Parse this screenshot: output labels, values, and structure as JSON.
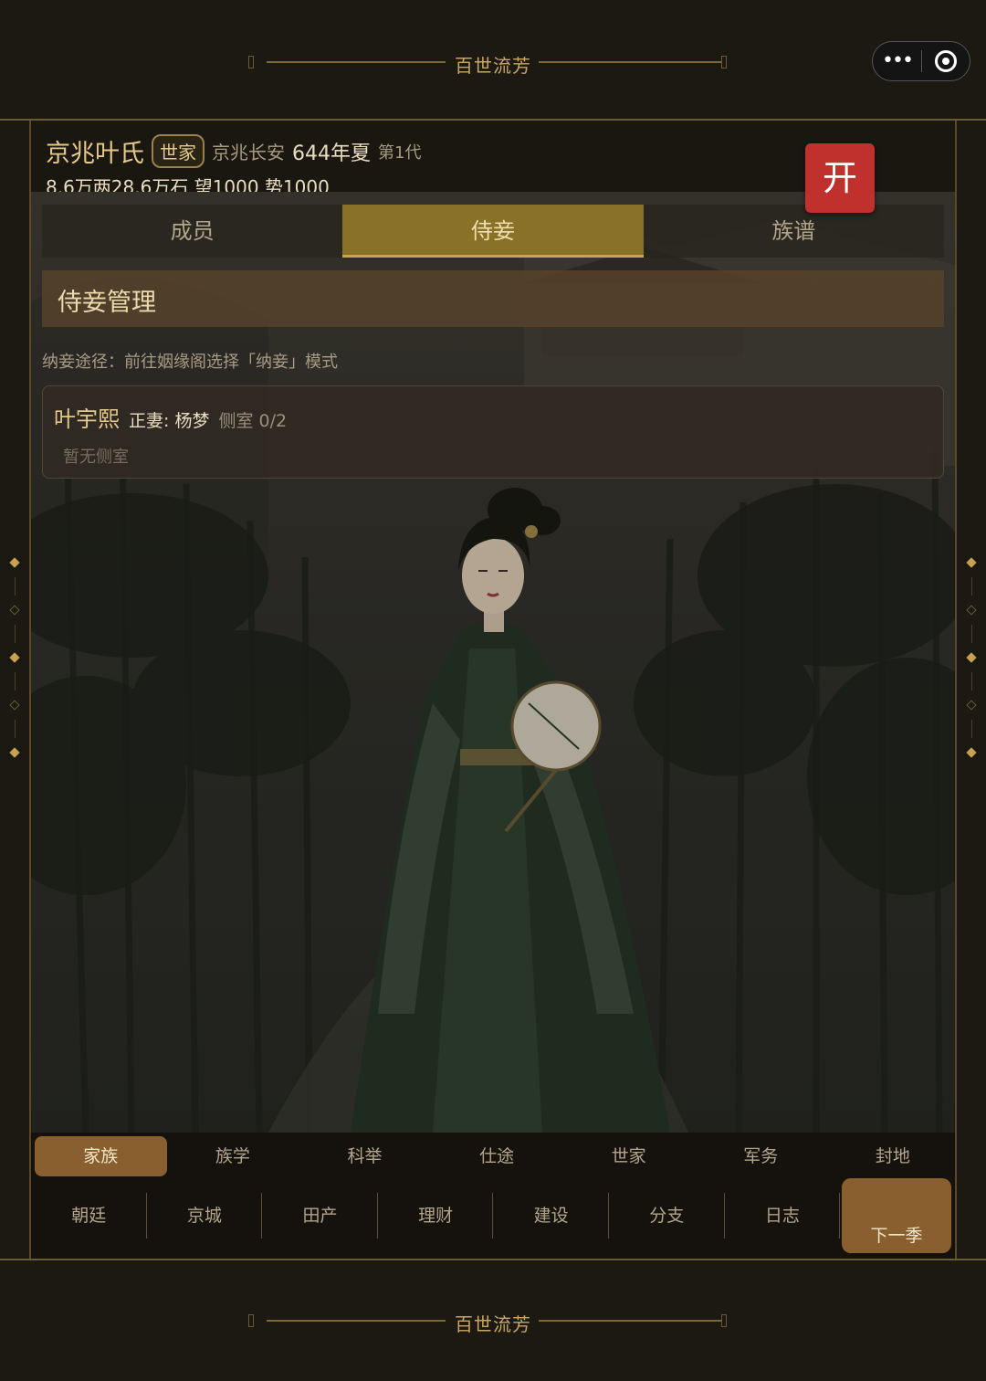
{
  "banner": {
    "title": "百世流芳"
  },
  "capsule": {
    "more_icon": "more-dots-icon",
    "close_icon": "target-circle-icon"
  },
  "header": {
    "clan_name": "京兆叶氏",
    "rank_badge": "世家",
    "location": "京兆长安",
    "season": "644年夏",
    "generation": "第1代",
    "resources": "8.6万两28.6万石  望1000 势1000",
    "open_button": "开",
    "open_button_color": "#c0302c"
  },
  "tabs": [
    {
      "label": "成员",
      "active": false
    },
    {
      "label": "侍妾",
      "active": true
    },
    {
      "label": "族谱",
      "active": false
    }
  ],
  "section": {
    "title": "侍妾管理",
    "hint": "纳妾途径：前往姻缘阁选择「纳妾」模式"
  },
  "member_card": {
    "name": "叶宇熙",
    "wife": "正妻: 杨梦",
    "side_count": "侧室 0/2",
    "empty_text": "暂无侧室"
  },
  "nav_row1": [
    "家族",
    "族学",
    "科举",
    "仕途",
    "世家",
    "军务",
    "封地"
  ],
  "nav_row2": [
    "朝廷",
    "京城",
    "田产",
    "理财",
    "建设",
    "分支",
    "日志"
  ],
  "next_season": "下一季",
  "colors": {
    "accent_gold": "#c9a64d",
    "nav_active": "#8a5f30",
    "background": "#1c1913"
  }
}
